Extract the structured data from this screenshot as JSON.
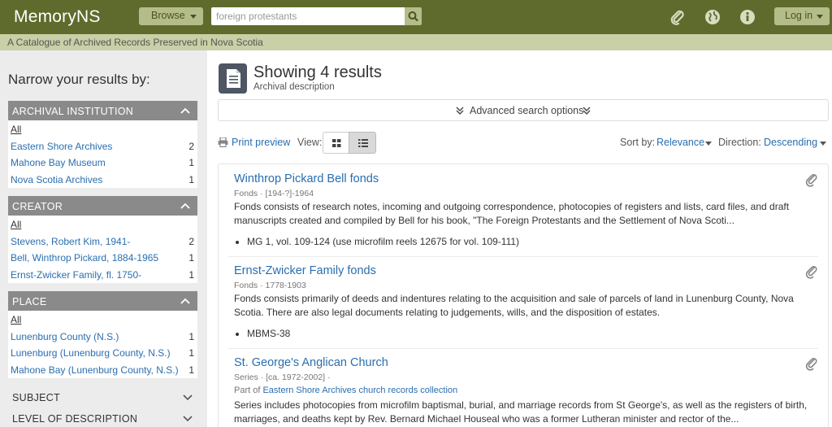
{
  "header": {
    "logo": "MemoryNS",
    "browse_label": "Browse",
    "search_value": "foreign protestants",
    "login_label": "Log in",
    "tagline": "A Catalogue of Archived Records Preserved in Nova Scotia",
    "icons": [
      "clipboard-icon",
      "globe-icon",
      "info-icon",
      "search-icon"
    ]
  },
  "sidebar": {
    "title": "Narrow your results by:",
    "facets": [
      {
        "name": "ARCHIVAL INSTITUTION",
        "items": [
          {
            "label": "All",
            "count": ""
          },
          {
            "label": "Eastern Shore Archives",
            "count": "2"
          },
          {
            "label": "Mahone Bay Museum",
            "count": "1"
          },
          {
            "label": "Nova Scotia Archives",
            "count": "1"
          }
        ]
      },
      {
        "name": "CREATOR",
        "items": [
          {
            "label": "All",
            "count": ""
          },
          {
            "label": "Stevens, Robert Kim, 1941-",
            "count": "2"
          },
          {
            "label": "Bell, Winthrop Pickard, 1884-1965",
            "count": "1"
          },
          {
            "label": "Ernst-Zwicker Family, fl. 1750-",
            "count": "1"
          }
        ]
      },
      {
        "name": "PLACE",
        "items": [
          {
            "label": "All",
            "count": ""
          },
          {
            "label": "Lunenburg County (N.S.)",
            "count": "1"
          },
          {
            "label": "Lunenburg (Lunenburg County, N.S.)",
            "count": "1"
          },
          {
            "label": "Mahone Bay (Lunenburg County, N.S.)",
            "count": "1"
          }
        ]
      }
    ],
    "collapsed": [
      "SUBJECT",
      "LEVEL OF DESCRIPTION"
    ]
  },
  "main": {
    "results_title": "Showing 4 results",
    "results_subtitle": "Archival description",
    "advanced_label": "Advanced search options",
    "print_label": "Print preview",
    "view_label": "View:",
    "sort_label": "Sort by:",
    "sort_value": "Relevance",
    "direction_label": "Direction:",
    "direction_value": "Descending",
    "results": [
      {
        "title": "Winthrop Pickard Bell fonds",
        "level": "Fonds",
        "dates": "[194-?]-1964",
        "description": "Fonds consists of research notes, incoming and outgoing correspondence, photocopies of registers and lists, card files, and draft manuscripts created and compiled by Bell for his book, \"The Foreign Protestants and the Settlement of Nova Scoti...",
        "bullet": "MG 1, vol. 109-124 (use microfilm reels 12675 for vol. 109-111)"
      },
      {
        "title": "Ernst-Zwicker Family fonds",
        "level": "Fonds",
        "dates": "1778-1903",
        "description": "Fonds consists primarily of deeds and indentures relating to the acquisition and sale of parcels of land in Lunenburg County, Nova Scotia. There are also legal documents relating to judgements, wills, and the disposition of estates.",
        "bullet": "MBMS-38"
      },
      {
        "title": "St. George's Anglican Church",
        "level": "Series",
        "dates": "[ca. 1972-2002]",
        "part_of_label": "Part of",
        "part_of": "Eastern Shore Archives church records collection",
        "description": "Series includes photocopies from microfilm baptismal, burial, and marriage records from St George's, as well as the registers of birth, marriages, and deaths kept by Rev. Bernard Michael Houseal who was a former Lutheran minister and rector of the..."
      }
    ]
  },
  "colors": {
    "header_bg": "#5f6b2c",
    "tagline_bg": "#c9cfa6",
    "button_bg": "#b4bd8a",
    "facet_head_bg": "#8a8a8a",
    "link": "#2a6eb0",
    "sidebar_bg": "#ececec"
  }
}
